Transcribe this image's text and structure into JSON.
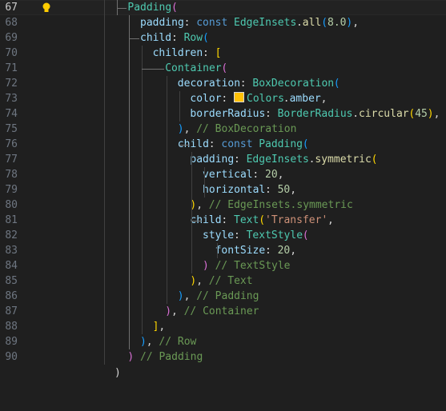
{
  "editor": {
    "current_line": "67",
    "swatch_color": "#ffc107",
    "lines": [
      {
        "num": "67",
        "segments": [
          {
            "t": "Padding",
            "c": "cls"
          },
          {
            "t": "(",
            "c": "b2"
          }
        ]
      },
      {
        "num": "68",
        "segments": [
          {
            "t": "padding",
            "c": "prop"
          },
          {
            "t": ": ",
            "c": "pun"
          },
          {
            "t": "const ",
            "c": "kw"
          },
          {
            "t": "EdgeInsets",
            "c": "cls"
          },
          {
            "t": ".",
            "c": "pun"
          },
          {
            "t": "all",
            "c": "fn"
          },
          {
            "t": "(",
            "c": "b3"
          },
          {
            "t": "8.0",
            "c": "num"
          },
          {
            "t": ")",
            "c": "b3"
          },
          {
            "t": ",",
            "c": "pun"
          }
        ]
      },
      {
        "num": "69",
        "segments": [
          {
            "t": "child",
            "c": "prop"
          },
          {
            "t": ": ",
            "c": "pun"
          },
          {
            "t": "Row",
            "c": "cls"
          },
          {
            "t": "(",
            "c": "b3"
          }
        ]
      },
      {
        "num": "70",
        "segments": [
          {
            "t": "children",
            "c": "prop"
          },
          {
            "t": ": ",
            "c": "pun"
          },
          {
            "t": "[",
            "c": "b1"
          }
        ]
      },
      {
        "num": "71",
        "segments": [
          {
            "t": "Container",
            "c": "cls"
          },
          {
            "t": "(",
            "c": "b2"
          }
        ]
      },
      {
        "num": "72",
        "segments": [
          {
            "t": "decoration",
            "c": "prop"
          },
          {
            "t": ": ",
            "c": "pun"
          },
          {
            "t": "BoxDecoration",
            "c": "cls"
          },
          {
            "t": "(",
            "c": "b3"
          }
        ]
      },
      {
        "num": "73",
        "segments": [
          {
            "t": "color",
            "c": "prop"
          },
          {
            "t": ": ",
            "c": "pun"
          },
          {
            "t": "Colors",
            "c": "cls",
            "swatch": true
          },
          {
            "t": ".",
            "c": "pun"
          },
          {
            "t": "amber",
            "c": "prop"
          },
          {
            "t": ",",
            "c": "pun"
          }
        ]
      },
      {
        "num": "74",
        "segments": [
          {
            "t": "borderRadius",
            "c": "prop"
          },
          {
            "t": ": ",
            "c": "pun"
          },
          {
            "t": "BorderRadius",
            "c": "cls"
          },
          {
            "t": ".",
            "c": "pun"
          },
          {
            "t": "circular",
            "c": "fn"
          },
          {
            "t": "(",
            "c": "b1"
          },
          {
            "t": "45",
            "c": "num"
          },
          {
            "t": ")",
            "c": "b1"
          },
          {
            "t": ",",
            "c": "pun"
          }
        ]
      },
      {
        "num": "75",
        "segments": [
          {
            "t": ")",
            "c": "b3"
          },
          {
            "t": ", ",
            "c": "pun"
          },
          {
            "t": "// BoxDecoration",
            "c": "cmt"
          }
        ]
      },
      {
        "num": "76",
        "segments": [
          {
            "t": "child",
            "c": "prop"
          },
          {
            "t": ": ",
            "c": "pun"
          },
          {
            "t": "const ",
            "c": "kw"
          },
          {
            "t": "Padding",
            "c": "cls"
          },
          {
            "t": "(",
            "c": "b3"
          }
        ]
      },
      {
        "num": "77",
        "segments": [
          {
            "t": "padding",
            "c": "prop"
          },
          {
            "t": ": ",
            "c": "pun"
          },
          {
            "t": "EdgeInsets",
            "c": "cls"
          },
          {
            "t": ".",
            "c": "pun"
          },
          {
            "t": "symmetric",
            "c": "fn"
          },
          {
            "t": "(",
            "c": "b1"
          }
        ]
      },
      {
        "num": "78",
        "segments": [
          {
            "t": "vertical",
            "c": "prop"
          },
          {
            "t": ": ",
            "c": "pun"
          },
          {
            "t": "20",
            "c": "num"
          },
          {
            "t": ",",
            "c": "pun"
          }
        ]
      },
      {
        "num": "79",
        "segments": [
          {
            "t": "horizontal",
            "c": "prop"
          },
          {
            "t": ": ",
            "c": "pun"
          },
          {
            "t": "50",
            "c": "num"
          },
          {
            "t": ",",
            "c": "pun"
          }
        ]
      },
      {
        "num": "80",
        "segments": [
          {
            "t": ")",
            "c": "b1"
          },
          {
            "t": ", ",
            "c": "pun"
          },
          {
            "t": "// EdgeInsets.symmetric",
            "c": "cmt"
          }
        ]
      },
      {
        "num": "81",
        "segments": [
          {
            "t": "child",
            "c": "prop"
          },
          {
            "t": ": ",
            "c": "pun"
          },
          {
            "t": "Text",
            "c": "cls"
          },
          {
            "t": "(",
            "c": "b1"
          },
          {
            "t": "'Transfer'",
            "c": "str"
          },
          {
            "t": ",",
            "c": "pun"
          }
        ]
      },
      {
        "num": "82",
        "segments": [
          {
            "t": "style",
            "c": "prop"
          },
          {
            "t": ": ",
            "c": "pun"
          },
          {
            "t": "TextStyle",
            "c": "cls"
          },
          {
            "t": "(",
            "c": "b2"
          }
        ]
      },
      {
        "num": "83",
        "segments": [
          {
            "t": "fontSize",
            "c": "prop"
          },
          {
            "t": ": ",
            "c": "pun"
          },
          {
            "t": "20",
            "c": "num"
          },
          {
            "t": ",",
            "c": "pun"
          }
        ]
      },
      {
        "num": "84",
        "segments": [
          {
            "t": ")",
            "c": "b2"
          },
          {
            "t": " ",
            "c": "pun"
          },
          {
            "t": "// TextStyle",
            "c": "cmt"
          }
        ]
      },
      {
        "num": "85",
        "segments": [
          {
            "t": ")",
            "c": "b1"
          },
          {
            "t": ", ",
            "c": "pun"
          },
          {
            "t": "// Text",
            "c": "cmt"
          }
        ]
      },
      {
        "num": "86",
        "segments": [
          {
            "t": ")",
            "c": "b3"
          },
          {
            "t": ", ",
            "c": "pun"
          },
          {
            "t": "// Padding",
            "c": "cmt"
          }
        ]
      },
      {
        "num": "87",
        "segments": [
          {
            "t": ")",
            "c": "b2"
          },
          {
            "t": ", ",
            "c": "pun"
          },
          {
            "t": "// Container",
            "c": "cmt"
          }
        ]
      },
      {
        "num": "88",
        "segments": [
          {
            "t": "]",
            "c": "b1"
          },
          {
            "t": ",",
            "c": "pun"
          }
        ]
      },
      {
        "num": "89",
        "segments": [
          {
            "t": ")",
            "c": "b3"
          },
          {
            "t": ", ",
            "c": "pun"
          },
          {
            "t": "// Row",
            "c": "cmt"
          }
        ]
      },
      {
        "num": "90",
        "segments": [
          {
            "t": ")",
            "c": "b2"
          },
          {
            "t": " ",
            "c": "pun"
          },
          {
            "t": "// Padding",
            "c": "cmt"
          }
        ]
      }
    ]
  }
}
